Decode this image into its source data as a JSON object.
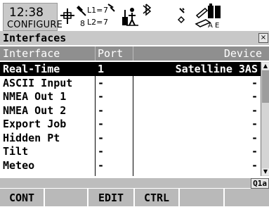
{
  "status": {
    "time": "12:38",
    "mode": "CONFIGURE",
    "l1_label": "L1=",
    "l1_count": "7",
    "l2_label": "L2=",
    "l2_count": "7",
    "sat_count": "8",
    "icon_labels": [
      "A",
      "E"
    ]
  },
  "window": {
    "title": "Interfaces",
    "close_label": "×"
  },
  "table": {
    "columns": [
      "Interface",
      "Port",
      "Device"
    ],
    "rows": [
      {
        "interface": "Real-Time",
        "port": "1",
        "device": "Satelline 3AS",
        "selected": true
      },
      {
        "interface": "ASCII Input",
        "port": "-",
        "device": "-"
      },
      {
        "interface": "NMEA Out 1",
        "port": "-",
        "device": "-"
      },
      {
        "interface": "NMEA Out 2",
        "port": "-",
        "device": "-"
      },
      {
        "interface": "Export Job",
        "port": "-",
        "device": "-"
      },
      {
        "interface": "Hidden Pt",
        "port": "-",
        "device": "-"
      },
      {
        "interface": "Tilt",
        "port": "-",
        "device": "-"
      },
      {
        "interface": "Meteo",
        "port": "-",
        "device": "-"
      }
    ]
  },
  "page_indicator": "Q1a",
  "fkeys": [
    "CONT",
    "",
    "EDIT",
    "CTRL",
    "",
    ""
  ]
}
